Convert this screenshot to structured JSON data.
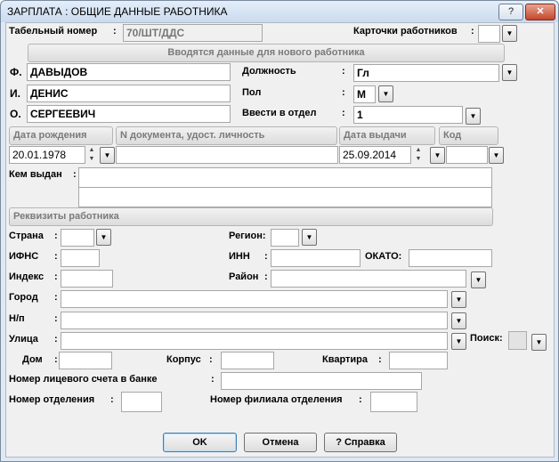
{
  "window": {
    "title": "ЗАРПЛАТА : ОБЩИЕ ДАННЫЕ РАБОТНИКА",
    "help_btn": "?",
    "close_btn": "✕"
  },
  "tabno": {
    "label": "Табельный номер",
    "colon": ":",
    "value": "70/ШТ/ДДС"
  },
  "cards": {
    "label": "Карточки работников",
    "colon": ":",
    "value": ""
  },
  "new_worker_banner": "Вводятся данные для нового работника",
  "name": {
    "f_label": "Ф.",
    "f_value": "ДАВЫДОВ",
    "i_label": "И.",
    "i_value": "ДЕНИС",
    "o_label": "О.",
    "o_value": "СЕРГЕЕВИЧ"
  },
  "position": {
    "label": "Должность",
    "colon": ":",
    "value": "Гл"
  },
  "gender": {
    "label": "Пол",
    "colon": ":",
    "value": "М"
  },
  "department": {
    "label": "Ввести в отдел",
    "colon": ":",
    "value": "1"
  },
  "doc_headers": {
    "birth": "Дата рождения",
    "docnum": "N документа, удост. личность",
    "issue": "Дата выдачи",
    "code": "Код"
  },
  "doc_values": {
    "birth": "20.01.1978",
    "docnum": "",
    "issue": "25.09.2014",
    "code": ""
  },
  "issued_by": {
    "label": "Кем выдан",
    "colon": ":",
    "line1": "",
    "line2": ""
  },
  "requisites_header": "Реквизиты работника",
  "address": {
    "country_label": "Страна",
    "country_colon": ":",
    "country": "",
    "region_label": "Регион:",
    "region": "",
    "ifns_label": "ИФНС",
    "ifns_colon": ":",
    "ifns": "",
    "inn_label": "ИНН",
    "inn_colon": ":",
    "inn": "",
    "okato_label": "ОКАТО:",
    "okato": "",
    "index_label": "Индекс",
    "index_colon": ":",
    "index": "",
    "district_label": "Район",
    "district_colon": ":",
    "district": "",
    "city_label": "Город",
    "city_colon": ":",
    "city": "",
    "np_label": "Н/п",
    "np_colon": ":",
    "np": "",
    "street_label": "Улица",
    "street_colon": ":",
    "street": "",
    "search_label": "Поиск:",
    "house_label": "Дом",
    "house_colon": ":",
    "house": "",
    "building_label": "Корпус",
    "building_colon": ":",
    "building": "",
    "apt_label": "Квартира",
    "apt_colon": ":",
    "apt": ""
  },
  "bank": {
    "account_label": "Номер лицевого счета в банке",
    "account_colon": ":",
    "account": "",
    "dept_label": "Номер отделения",
    "dept_colon": ":",
    "dept": "",
    "branch_label": "Номер филиала отделения",
    "branch_colon": ":",
    "branch": ""
  },
  "buttons": {
    "ok": "OK",
    "cancel": "Отмена",
    "help": "? Справка"
  },
  "icons": {
    "dropdown": "▼",
    "spin_up": "▲",
    "spin_down": "▼"
  }
}
